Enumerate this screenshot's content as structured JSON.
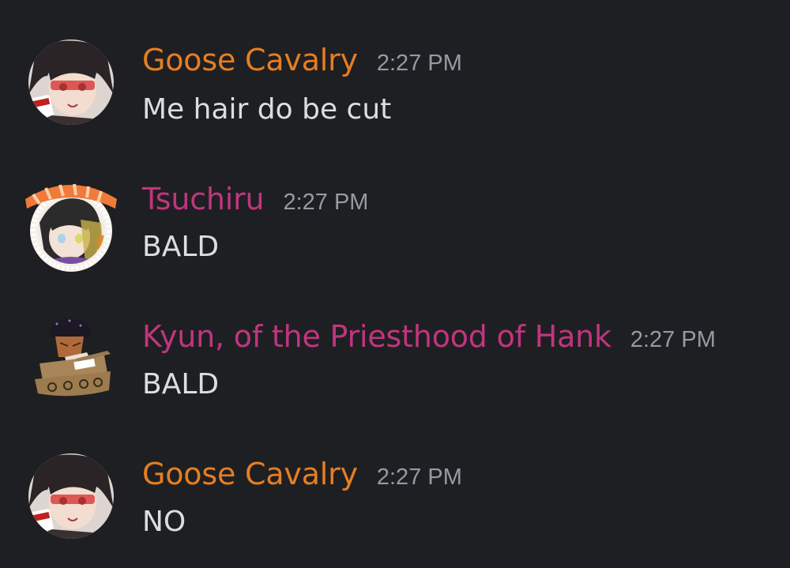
{
  "messages": [
    {
      "username": "Goose Cavalry",
      "username_color": "#e67e22",
      "timestamp": "2:27 PM",
      "content": "Me hair do be cut",
      "avatar_icon": "anime-girl-avatar-icon"
    },
    {
      "username": "Tsuchiru",
      "username_color": "#c0357f",
      "timestamp": "2:27 PM",
      "content": "BALD",
      "avatar_icon": "sushi-frame-avatar-icon"
    },
    {
      "username": "Kyun, of the Priesthood of Hank",
      "username_color": "#c0357f",
      "timestamp": "2:27 PM",
      "content": "BALD",
      "avatar_icon": "cardboard-tank-avatar-icon"
    },
    {
      "username": "Goose Cavalry",
      "username_color": "#e67e22",
      "timestamp": "2:27 PM",
      "content": "NO",
      "avatar_icon": "anime-girl-avatar-icon"
    }
  ]
}
